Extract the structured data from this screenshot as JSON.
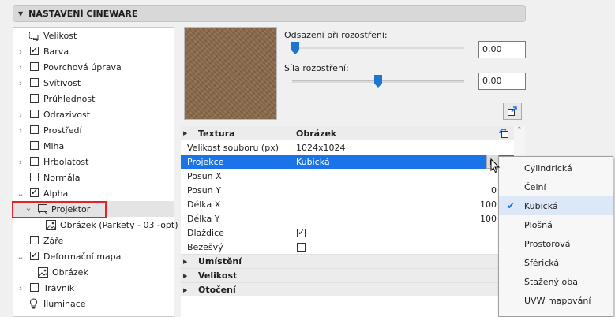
{
  "header": {
    "title": "NASTAVENÍ CINEWARE"
  },
  "tree": [
    {
      "label": "Velikost",
      "icon": "resize-icon",
      "chevron": false,
      "checkbox": null
    },
    {
      "label": "Barva",
      "chevron": true,
      "checkbox": true
    },
    {
      "label": "Povrchová úprava",
      "chevron": true,
      "checkbox": false
    },
    {
      "label": "Svítivost",
      "chevron": true,
      "checkbox": false
    },
    {
      "label": "Průhlednost",
      "chevron": false,
      "checkbox": false
    },
    {
      "label": "Odrazivost",
      "chevron": true,
      "checkbox": false
    },
    {
      "label": "Prostředí",
      "chevron": true,
      "checkbox": false
    },
    {
      "label": "Mlha",
      "chevron": false,
      "checkbox": false
    },
    {
      "label": "Hrbolatost",
      "chevron": true,
      "checkbox": false
    },
    {
      "label": "Normála",
      "chevron": false,
      "checkbox": false
    },
    {
      "label": "Alpha",
      "chevron": true,
      "checkbox": true
    },
    {
      "label": "Projektor",
      "icon": "projector-icon",
      "chevron": true,
      "checkbox": null,
      "selected": true
    },
    {
      "label": "Obrázek (Parkety - 03 -opt)",
      "icon": "image-icon",
      "chevron": false,
      "checkbox": null
    },
    {
      "label": "Záře",
      "chevron": false,
      "checkbox": false
    },
    {
      "label": "Deformační mapa",
      "chevron": true,
      "checkbox": true
    },
    {
      "label": "Obrázek",
      "icon": "image-icon",
      "chevron": false,
      "checkbox": null
    },
    {
      "label": "Trávník",
      "chevron": true,
      "checkbox": false
    },
    {
      "label": "Iluminace",
      "icon": "lightbulb-icon",
      "chevron": false,
      "checkbox": null
    }
  ],
  "sliders": {
    "offset_label": "Odsazení při rozostření:",
    "offset_value": "0,00",
    "offset_level": 0.0,
    "strength_label": "Síla rozostření:",
    "strength_value": "0,00",
    "strength_level": 0.5
  },
  "table": {
    "header": {
      "key": "Textura",
      "value": "Obrázek"
    },
    "rows": {
      "size_key": "Velikost souboru (px)",
      "size_val": "1024x1024",
      "proj_key": "Projekce",
      "proj_val": "Kubická",
      "posx_key": "Posun X",
      "posy_key": "Posun Y",
      "posy_val": "0",
      "lenx_key": "Délka X",
      "lenx_val": "100",
      "leny_key": "Délka Y",
      "leny_val": "100",
      "tile_key": "Dlaždice",
      "tile_checked": true,
      "seam_key": "Bezešvý",
      "seam_checked": false
    },
    "sections": {
      "placement": "Umístění",
      "size": "Velikost",
      "rotation": "Otočení"
    }
  },
  "menu": {
    "items": [
      "Cylindrická",
      "Čelní",
      "Kubická",
      "Plošná",
      "Prostorová",
      "Sférická",
      "Stažený obal",
      "UVW mapování"
    ],
    "selected_index": 2
  },
  "colors": {
    "accent": "#1a73e8",
    "highlight_red": "#e0242a"
  }
}
